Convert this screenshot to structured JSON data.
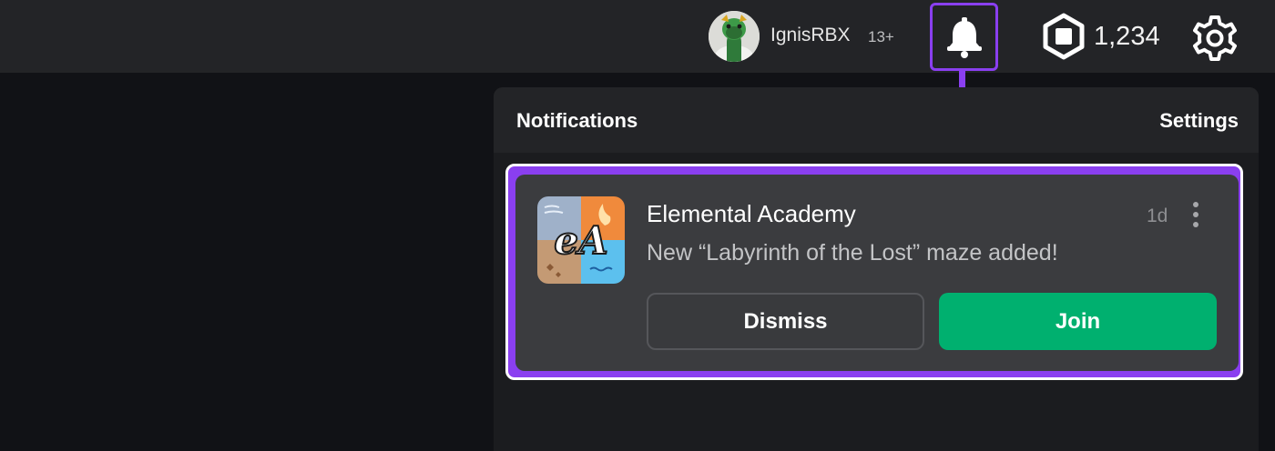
{
  "header": {
    "username": "IgnisRBX",
    "age_badge": "13+",
    "robux_amount": "1,234",
    "icons": [
      "avatar",
      "bell-icon",
      "robux-icon",
      "gear-icon"
    ]
  },
  "notifications_panel": {
    "title": "Notifications",
    "settings_label": "Settings",
    "items": [
      {
        "game": "Elemental Academy",
        "thumbnail_text": "eA",
        "time": "1d",
        "message": "New “Labyrinth of the Lost” maze added!",
        "dismiss_label": "Dismiss",
        "join_label": "Join"
      }
    ]
  },
  "colors": {
    "highlight": "#8a3ff0",
    "join": "#00b06f",
    "topbar": "#232427",
    "background": "#111216",
    "card": "#3b3c3f"
  }
}
